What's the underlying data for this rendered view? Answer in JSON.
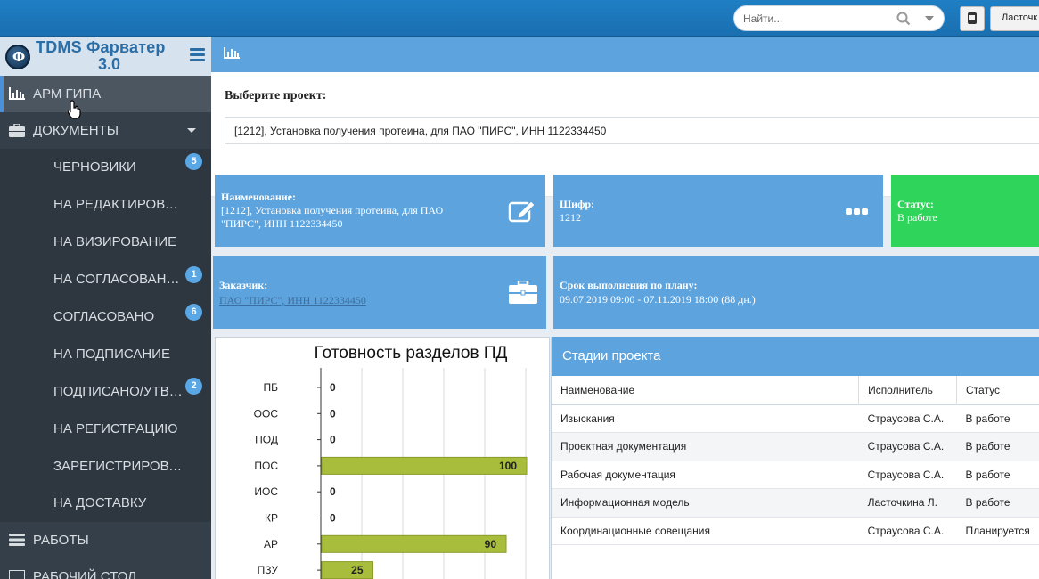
{
  "topbar": {
    "search_placeholder": "Найти...",
    "user_label": "Ласточк"
  },
  "sidebar": {
    "brand_title": "TDMS Фарватер",
    "brand_version": "3.0",
    "logo_letter": "Ф",
    "items": [
      {
        "label": "АРМ ГИПА",
        "icon": "bar-chart-icon",
        "active": true
      },
      {
        "label": "ДОКУМЕНТЫ",
        "icon": "briefcase-icon",
        "expanded": true
      },
      {
        "label": "РАБОТЫ",
        "icon": "list-icon"
      },
      {
        "label": "РАБОЧИЙ СТОЛ",
        "icon": "desktop-icon"
      }
    ],
    "documents": [
      {
        "label": "ЧЕРНОВИКИ",
        "badge": "5"
      },
      {
        "label": "НА РЕДАКТИРОВАНИЕ",
        "badge": ""
      },
      {
        "label": "НА ВИЗИРОВАНИЕ",
        "badge": ""
      },
      {
        "label": "НА СОГЛАСОВАНИЕ",
        "badge": "1"
      },
      {
        "label": "СОГЛАСОВАНО",
        "badge": "6"
      },
      {
        "label": "НА ПОДПИСАНИЕ",
        "badge": ""
      },
      {
        "label": "ПОДПИСАНО/УТВЕРЖДЕНО",
        "badge": "2"
      },
      {
        "label": "НА РЕГИСТРАЦИЮ",
        "badge": ""
      },
      {
        "label": "ЗАРЕГИСТРИРОВАНО",
        "badge": ""
      },
      {
        "label": "НА ДОСТАВКУ",
        "badge": ""
      }
    ]
  },
  "project": {
    "select_label": "Выберите проект:",
    "selected": "[1212], Установка получения протеина, для ПАО \"ПИРС\", ИНН 1122334450"
  },
  "cards": {
    "name_caption": "Наименование:",
    "name_value": "[1212], Установка получения протеина, для ПАО \"ПИРС\", ИНН 1122334450",
    "cipher_caption": "Шифр:",
    "cipher_value": "1212",
    "status_caption": "Статус:",
    "status_value": "В работе",
    "customer_caption": "Заказчик:",
    "customer_value": "ПАО \"ПИРС\", ИНН 1122334450",
    "deadline_caption": "Срок выполнения по плану:",
    "deadline_value": "09.07.2019 09:00 - 07.11.2019 18:00 (88 дн.)",
    "status_color": "#2fd45a",
    "card_color": "#5da3dd"
  },
  "chart_data": {
    "type": "bar",
    "orientation": "horizontal",
    "title": "Готовность разделов ПД",
    "categories": [
      "ПБ",
      "ООС",
      "ПОД",
      "ПОС",
      "ИОС",
      "КР",
      "АР",
      "ПЗУ"
    ],
    "values": [
      0,
      0,
      0,
      100,
      0,
      0,
      90,
      25
    ],
    "xlim": [
      0,
      100
    ],
    "grid": true,
    "bar_color": "#a9bd3c"
  },
  "stages": {
    "title": "Стадии проекта",
    "columns": [
      "Наименование",
      "Исполнитель",
      "Статус"
    ],
    "rows": [
      [
        "Изыскания",
        "Страусова С.А.",
        "В работе"
      ],
      [
        "Проектная документация",
        "Страусова С.А.",
        "В работе"
      ],
      [
        "Рабочая документация",
        "Страусова С.А.",
        "В работе"
      ],
      [
        "Информационная модель",
        "Ласточкина Л.",
        "В работе"
      ],
      [
        "Координационные совещания",
        "Страусова С.А.",
        "Планируется"
      ]
    ]
  }
}
